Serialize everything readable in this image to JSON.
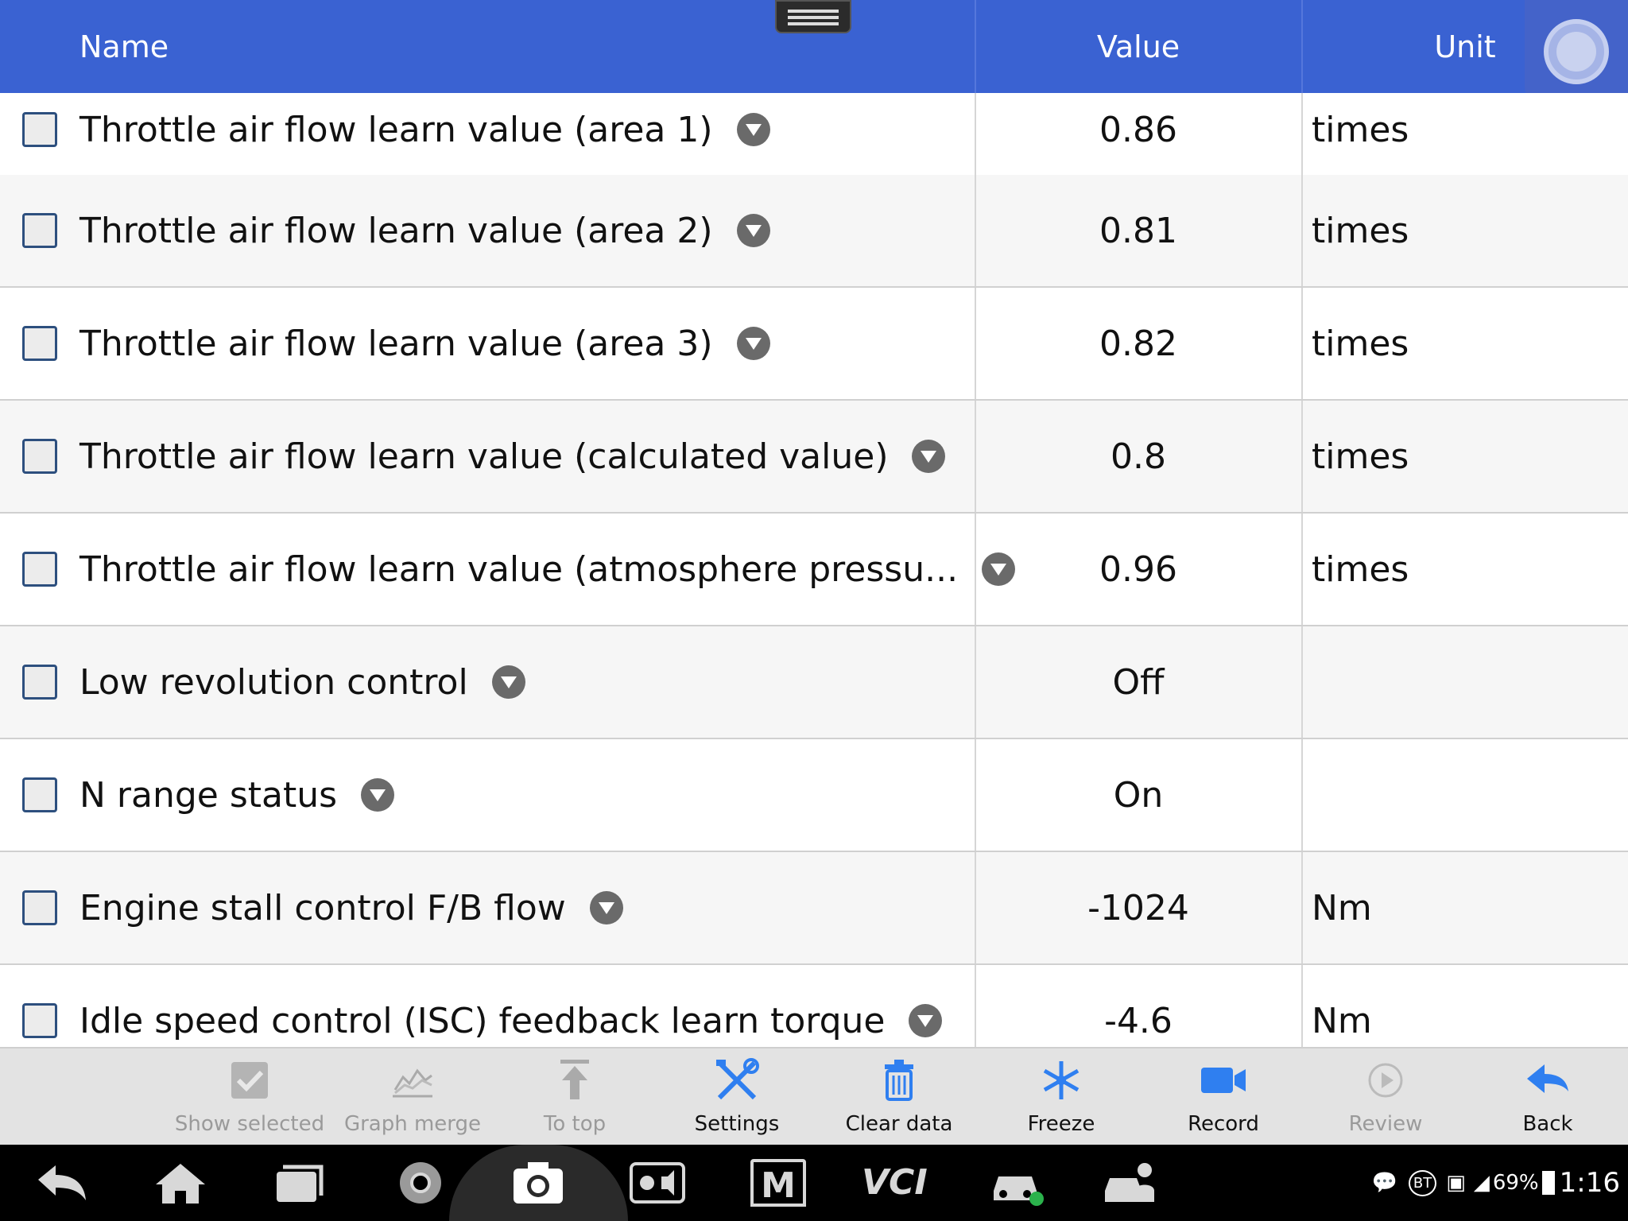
{
  "header": {
    "name": "Name",
    "value": "Value",
    "unit": "Unit"
  },
  "rows": [
    {
      "name": "Throttle air flow learn value (area 1)",
      "value": "0.86",
      "unit": "times"
    },
    {
      "name": "Throttle air flow learn value (area 2)",
      "value": "0.81",
      "unit": "times"
    },
    {
      "name": "Throttle air flow learn value (area 3)",
      "value": "0.82",
      "unit": "times"
    },
    {
      "name": "Throttle air flow learn value (calculated value)",
      "value": "0.8",
      "unit": "times"
    },
    {
      "name": "Throttle air flow learn value (atmosphere pressu...",
      "value": "0.96",
      "unit": "times"
    },
    {
      "name": "Low revolution control",
      "value": "Off",
      "unit": ""
    },
    {
      "name": "N range status",
      "value": "On",
      "unit": ""
    },
    {
      "name": "Engine stall control F/B flow",
      "value": "-1024",
      "unit": "Nm"
    },
    {
      "name": "Idle speed control (ISC) feedback learn torque",
      "value": "-4.6",
      "unit": "Nm"
    }
  ],
  "toolbar": {
    "show_selected": "Show selected",
    "graph_merge": "Graph merge",
    "to_top": "To top",
    "settings": "Settings",
    "clear_data": "Clear data",
    "freeze": "Freeze",
    "record": "Record",
    "review": "Review",
    "back": "Back"
  },
  "status": {
    "bt": "BT",
    "battery": "69%",
    "time": "1:16"
  },
  "nav": {
    "vci": "VCI",
    "m": "M"
  },
  "colors": {
    "header": "#3a62d2",
    "toolbar_active_icon": "#2f7ff0",
    "toolbar_disabled": "#9a9a9a"
  }
}
